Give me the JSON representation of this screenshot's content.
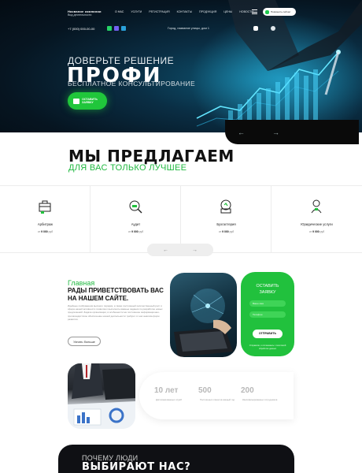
{
  "header": {
    "company_title": "Название компании",
    "company_subtitle": "Вид деятельности",
    "nav": [
      {
        "label": "О НАС"
      },
      {
        "label": "УСЛУГИ"
      },
      {
        "label": "РЕГИСТРАЦИЯ"
      },
      {
        "label": "КОНТАКТЫ"
      },
      {
        "label": "ПРОДУКЦИЯ"
      },
      {
        "label": "ЦЕНЫ"
      },
      {
        "label": "НОВОСТИ"
      }
    ],
    "cta": "Позвонить сейчас",
    "phone": "+7 (000) 000-00-00",
    "address": "Город, название улицы, дом 1",
    "icons": [
      "whatsapp-icon",
      "viber-icon",
      "telegram-icon",
      "youtube-icon",
      "vk-icon"
    ]
  },
  "hero": {
    "line1": "ДОВЕРЬТЕ РЕШЕНИЕ",
    "big": "ПРОФИ",
    "sub": "БЕСПЛАТНОЕ КОНСУЛЬТИРОВАНИЕ",
    "button": "ОСТАВИТЬ ЗАЯВКУ"
  },
  "offer": {
    "title": "МЫ ПРЕДЛАГАЕМ",
    "subtitle": "ДЛЯ ВАС ТОЛЬКО ЛУЧШЕЕ"
  },
  "services": [
    {
      "name": "Арбитраж",
      "price_prefix": "от",
      "price": "9 000",
      "currency": "руб",
      "icon": "briefcase-icon"
    },
    {
      "name": "Аудит",
      "price_prefix": "от",
      "price": "9 000",
      "currency": "руб",
      "icon": "audit-icon"
    },
    {
      "name": "Бухгалтерия",
      "price_prefix": "от",
      "price": "9 000",
      "currency": "руб",
      "icon": "accounting-icon"
    },
    {
      "name": "Юридические услуги",
      "price_prefix": "от",
      "price": "9 000",
      "currency": "руб",
      "icon": "legal-icon"
    }
  ],
  "about": {
    "label": "Главная",
    "heading": "РАДЫ ПРИВЕТСТВОВАТЬ ВАС НА НАШЕМ САЙТЕ.",
    "text": "Идейные соображения высшего порядка, а также постоянный количественный рост и сфера нашей активности позволяют выполнять важные задания по разработке новых предложений. Задача организации, в особенности же постоянное информационно-пропагандистское обеспечение нашей деятельности требуют от нас анализа форм развития.",
    "more": "Узнать больше"
  },
  "form": {
    "title_1": "ОСТАВИТЬ",
    "title_2": "ЗАЯВКУ",
    "name_ph": "Ваше имя",
    "phone_ph": "Телефон",
    "submit": "ОТПРАВИТЬ",
    "consent": "Отправляя, я соглашаюсь с политикой обработки данных"
  },
  "stats": [
    {
      "number": "10 лет",
      "desc": "Дипломированных служб"
    },
    {
      "number": "500",
      "desc": "Постоянных клиентов каждый год"
    },
    {
      "number": "200",
      "desc": "Квалифицированных сотрудников"
    }
  ],
  "why": {
    "line1": "ПОЧЕМУ ЛЮДИ",
    "line2": "ВЫБИРАЮТ НАС?"
  },
  "colors": {
    "accent": "#21c13d",
    "dark": "#0f1014",
    "hero_bg": "#0a2e44"
  }
}
